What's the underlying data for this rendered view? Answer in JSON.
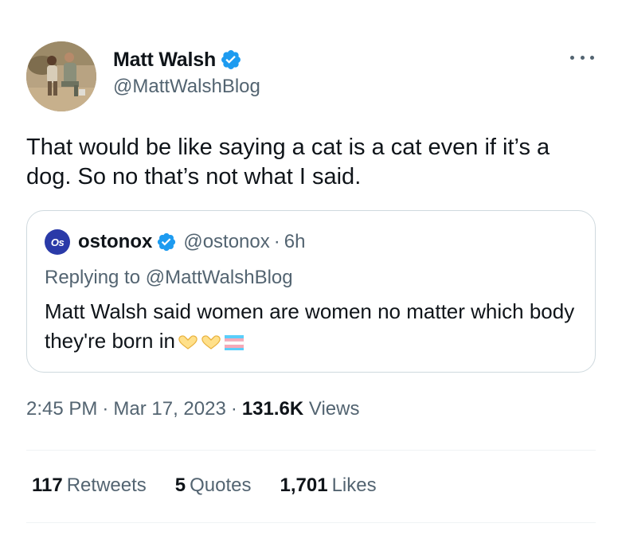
{
  "author": {
    "name": "Matt Walsh",
    "handle": "@MattWalshBlog"
  },
  "tweet_text": "That would be like saying a cat is a cat even if it’s a dog. So no that’s not what I said.",
  "quoted_tweet": {
    "logo_text": "Os",
    "name": "ostonox",
    "handle": "@ostonox",
    "dot": "·",
    "time": "6h",
    "replying_to": "Replying to @MattWalshBlog",
    "text": "Matt Walsh said women are women no matter which body they're born in",
    "emojis": [
      "hand-heart-emoji",
      "hand-heart-emoji",
      "transgender-flag-emoji"
    ]
  },
  "meta": {
    "time": "2:45 PM",
    "sep": "·",
    "date": "Mar 17, 2023",
    "views_count": "131.6K",
    "views_label": "Views"
  },
  "stats": {
    "retweets_count": "117",
    "retweets_label": "Retweets",
    "quotes_count": "5",
    "quotes_label": "Quotes",
    "likes_count": "1,701",
    "likes_label": "Likes"
  },
  "colors": {
    "verified": "#1d9bf0",
    "secondary_text": "#536471",
    "primary_text": "#0f1419",
    "border": "#cfd9de"
  }
}
